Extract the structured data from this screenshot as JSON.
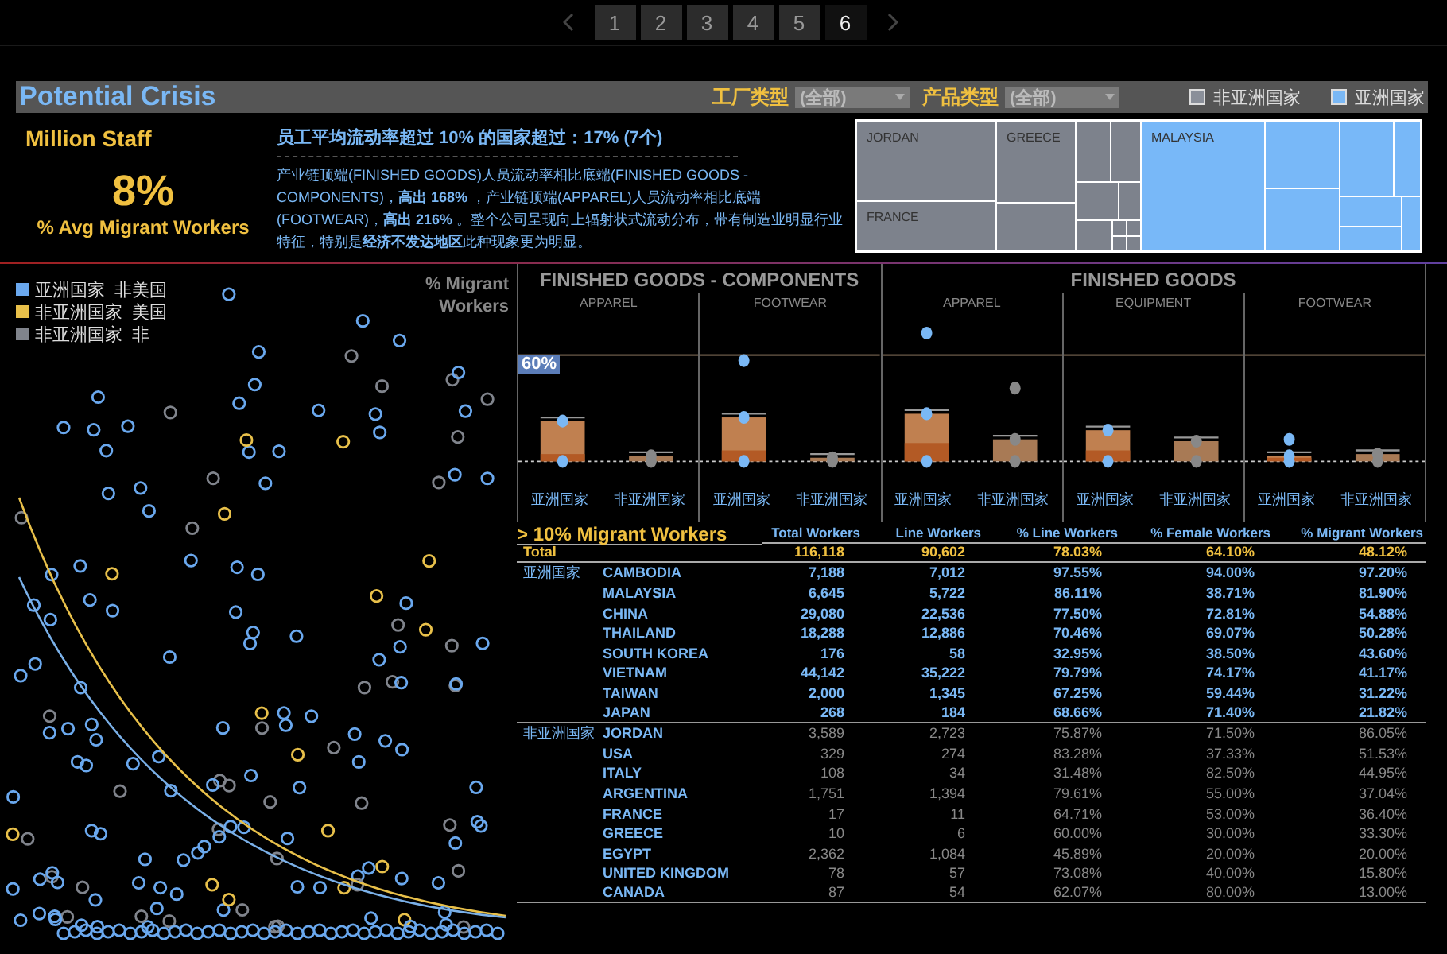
{
  "pager": {
    "pages": [
      {
        "label": "1",
        "selected": false
      },
      {
        "label": "2",
        "selected": false
      },
      {
        "label": "3",
        "selected": false
      },
      {
        "label": "4",
        "selected": false
      },
      {
        "label": "5",
        "selected": false
      },
      {
        "label": "6",
        "selected": true
      }
    ]
  },
  "header": {
    "title": "Potential Crisis",
    "filters": [
      {
        "label": "工厂类型",
        "value": "(全部)"
      },
      {
        "label": "产品类型",
        "value": "(全部)"
      }
    ],
    "legend": [
      {
        "label": "非亚洲国家",
        "color": "#8a8f99"
      },
      {
        "label": "亚洲国家",
        "color": "#7ab8f5"
      }
    ]
  },
  "kpi": {
    "title": "Million Staff",
    "value": "8%",
    "caption": "% Avg Migrant Workers"
  },
  "summary": {
    "headline": "员工平均流动率超过 10% 的国家超过：**17% (7个)**",
    "body": "产业链顶端(FINISHED GOODS)人员流动率相比底端(FINISHED GOODS - COMPONENTS)，**高出 168%** ，产业链顶端(APPAREL)人员流动率相比底端(FOOTWEAR)，**高出 216%** 。整个公司呈现向上辐射状式流动分布，带有制造业明显行业特征，特别是**经济不发达地区**此种现象更为明显。"
  },
  "treemap": {
    "tiles": [
      {
        "label": "JORDAN",
        "color": "#7d828c"
      },
      {
        "label": "GREECE",
        "color": "#7d828c"
      },
      {
        "label": "MALAYSIA",
        "color": "#78b8f8"
      },
      {
        "label": "FRANCE",
        "color": "#7d828c"
      }
    ]
  },
  "scatter": {
    "legend": [
      {
        "label": "亚洲国家  非美国",
        "color": "#6aa8ee"
      },
      {
        "label": "非亚洲国家  美国",
        "color": "#e8c04a"
      },
      {
        "label": "非亚洲国家  非",
        "color": "#80848c"
      }
    ],
    "axis_title": "% Migrant Workers"
  },
  "boxplots": {
    "reference_label": "60%",
    "groups": [
      {
        "title": "FINISHED GOODS - COMPONENTS",
        "panels": [
          {
            "title": "APPAREL",
            "x_labels": [
              "亚洲国家",
              "非亚洲国家"
            ]
          },
          {
            "title": "FOOTWEAR",
            "x_labels": [
              "亚洲国家",
              "非亚洲国家"
            ]
          }
        ]
      },
      {
        "title": "FINISHED GOODS",
        "panels": [
          {
            "title": "APPAREL",
            "x_labels": [
              "亚洲国家",
              "非亚洲国家"
            ]
          },
          {
            "title": "EQUIPMENT",
            "x_labels": [
              "亚洲国家",
              "非亚洲国家"
            ]
          },
          {
            "title": "FOOTWEAR",
            "x_labels": [
              "亚洲国家",
              "非亚洲国家"
            ]
          }
        ]
      }
    ]
  },
  "table": {
    "title": "> 10% Migrant Workers",
    "columns": [
      "Total Workers",
      "Line Workers",
      "% Line Workers",
      "% Female Workers",
      "%  Migrant Workers"
    ],
    "total": {
      "label": "Total",
      "values": [
        "116,118",
        "90,602",
        "78.03%",
        "64.10%",
        "48.12%"
      ]
    },
    "groups": [
      {
        "name": "亚洲国家",
        "highlighted": true,
        "rows": [
          {
            "country": "CAMBODIA",
            "values": [
              "7,188",
              "7,012",
              "97.55%",
              "94.00%",
              "97.20%"
            ]
          },
          {
            "country": "MALAYSIA",
            "values": [
              "6,645",
              "5,722",
              "86.11%",
              "38.71%",
              "81.90%"
            ]
          },
          {
            "country": "CHINA",
            "values": [
              "29,080",
              "22,536",
              "77.50%",
              "72.81%",
              "54.88%"
            ]
          },
          {
            "country": "THAILAND",
            "values": [
              "18,288",
              "12,886",
              "70.46%",
              "69.07%",
              "50.28%"
            ]
          },
          {
            "country": "SOUTH KOREA",
            "values": [
              "176",
              "58",
              "32.95%",
              "38.50%",
              "43.60%"
            ]
          },
          {
            "country": "VIETNAM",
            "values": [
              "44,142",
              "35,222",
              "79.79%",
              "74.17%",
              "41.17%"
            ]
          },
          {
            "country": "TAIWAN",
            "values": [
              "2,000",
              "1,345",
              "67.25%",
              "59.44%",
              "31.22%"
            ]
          },
          {
            "country": "JAPAN",
            "values": [
              "268",
              "184",
              "68.66%",
              "71.40%",
              "21.82%"
            ]
          }
        ]
      },
      {
        "name": "非亚洲国家",
        "highlighted": false,
        "rows": [
          {
            "country": "JORDAN",
            "values": [
              "3,589",
              "2,723",
              "75.87%",
              "71.50%",
              "86.05%"
            ]
          },
          {
            "country": "USA",
            "values": [
              "329",
              "274",
              "83.28%",
              "37.33%",
              "51.53%"
            ]
          },
          {
            "country": "ITALY",
            "values": [
              "108",
              "34",
              "31.48%",
              "82.50%",
              "44.95%"
            ]
          },
          {
            "country": "ARGENTINA",
            "values": [
              "1,751",
              "1,394",
              "79.61%",
              "55.00%",
              "37.04%"
            ]
          },
          {
            "country": "FRANCE",
            "values": [
              "17",
              "11",
              "64.71%",
              "53.00%",
              "36.40%"
            ]
          },
          {
            "country": "GREECE",
            "values": [
              "10",
              "6",
              "60.00%",
              "30.00%",
              "33.30%"
            ]
          },
          {
            "country": "EGYPT",
            "values": [
              "2,362",
              "1,084",
              "45.89%",
              "20.00%",
              "20.00%"
            ]
          },
          {
            "country": "UNITED KINGDOM",
            "values": [
              "78",
              "57",
              "73.08%",
              "40.00%",
              "15.80%"
            ]
          },
          {
            "country": "CANADA",
            "values": [
              "87",
              "54",
              "62.07%",
              "80.00%",
              "13.00%"
            ]
          }
        ]
      }
    ]
  }
}
